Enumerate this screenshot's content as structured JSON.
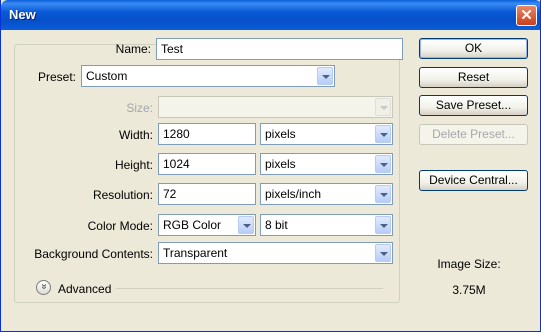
{
  "window": {
    "title": "New",
    "close_glyph": "✕"
  },
  "form": {
    "name": {
      "label": "Name:",
      "value": "Test"
    },
    "preset": {
      "label": "Preset:",
      "value": "Custom"
    },
    "size": {
      "label": "Size:",
      "value": ""
    },
    "width": {
      "label": "Width:",
      "value": "1280",
      "unit": "pixels"
    },
    "height": {
      "label": "Height:",
      "value": "1024",
      "unit": "pixels"
    },
    "resolution": {
      "label": "Resolution:",
      "value": "72",
      "unit": "pixels/inch"
    },
    "color_mode": {
      "label": "Color Mode:",
      "value": "RGB Color",
      "depth": "8 bit"
    },
    "background": {
      "label": "Background Contents:",
      "value": "Transparent"
    },
    "advanced": {
      "label": "Advanced",
      "icon": "chevron-double-down-icon",
      "glyph": "»"
    }
  },
  "buttons": {
    "ok": "OK",
    "reset": "Reset",
    "save_preset": "Save Preset...",
    "delete_preset": "Delete Preset...",
    "device_central": "Device Central..."
  },
  "image_size": {
    "label": "Image Size:",
    "value": "3.75M"
  },
  "colors": {
    "titlebar": "#0a59d6",
    "dialog_bg": "#ece9d8",
    "field_border": "#7f9db9",
    "button_border": "#003c74",
    "disabled_text": "#a7a6aa"
  }
}
